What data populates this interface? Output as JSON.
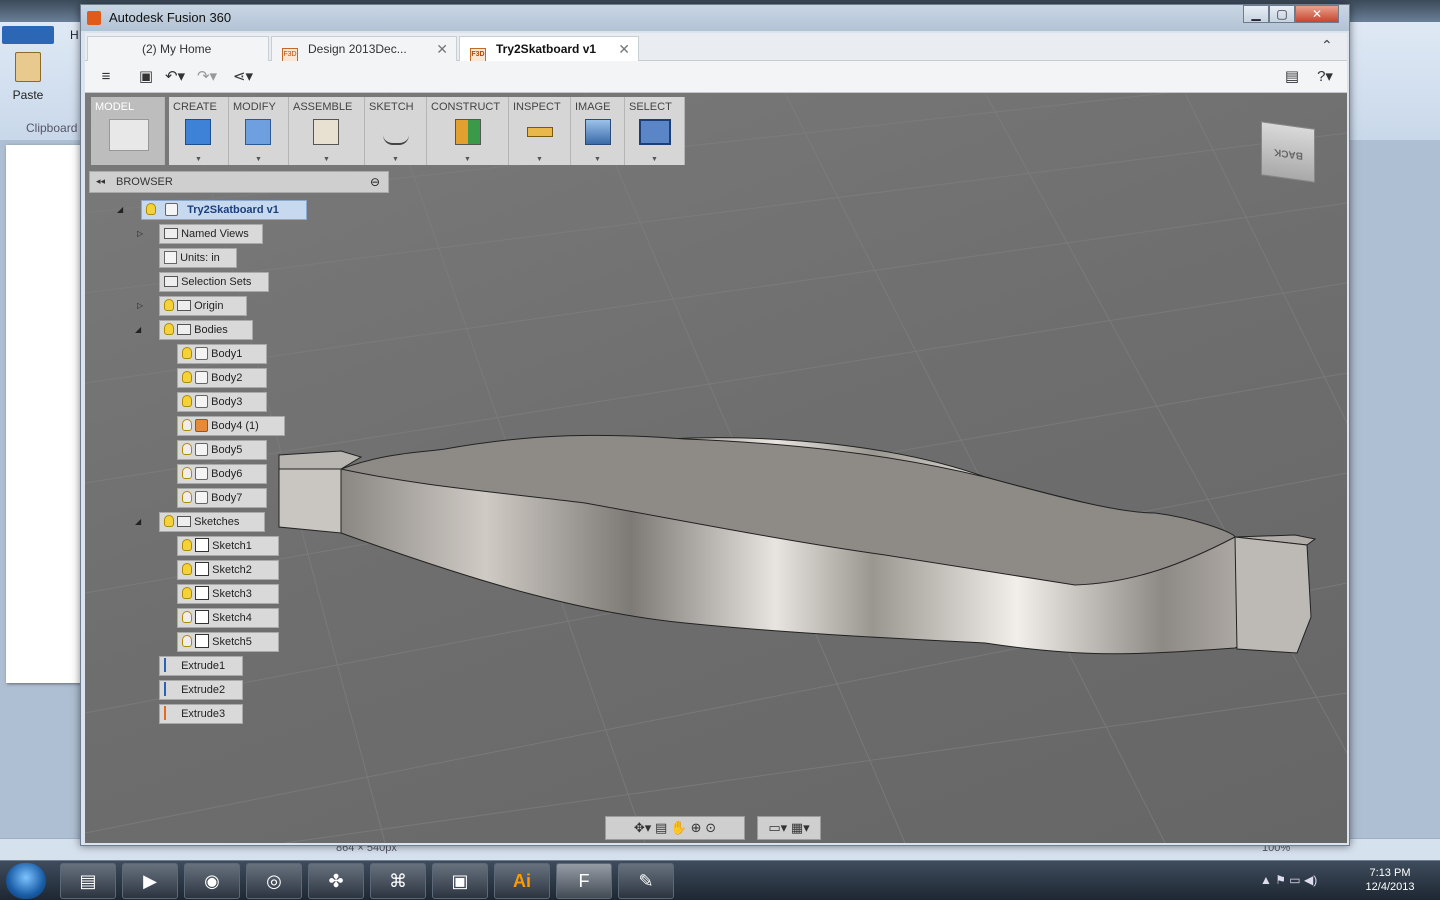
{
  "background_app": {
    "paste_label": "Paste",
    "clipboard_label": "Clipboard",
    "ribbon_tab_fragment": "H",
    "status_dimensions": "864 × 540px",
    "zoom_level": "100%"
  },
  "window": {
    "title": "Autodesk Fusion 360",
    "min_label": "▁",
    "max_label": "▢",
    "close_label": "✕"
  },
  "tabs": [
    {
      "label": "(2) My Home"
    },
    {
      "label": "Design 2013Dec..."
    },
    {
      "label": "Try2Skatboard v1"
    }
  ],
  "tab_close_label": "✕",
  "collapse_label": "⌃",
  "toolbar": {
    "groups": [
      {
        "label": "MODEL",
        "icon": "model-cube-icon"
      },
      {
        "label": "CREATE",
        "icon": "box-icon"
      },
      {
        "label": "MODIFY",
        "icon": "press-pull-icon"
      },
      {
        "label": "ASSEMBLE",
        "icon": "joint-icon"
      },
      {
        "label": "SKETCH",
        "icon": "sketch-curve-icon"
      },
      {
        "label": "CONSTRUCT",
        "icon": "plane-icon"
      },
      {
        "label": "INSPECT",
        "icon": "measure-icon"
      },
      {
        "label": "IMAGE",
        "icon": "render-icon"
      },
      {
        "label": "SELECT",
        "icon": "select-window-icon"
      }
    ],
    "dropdown_glyph": "▼"
  },
  "browser": {
    "title": "BROWSER",
    "collapse_glyph": "◂◂",
    "minus_glyph": "⊖",
    "root": "Try2Skatboard v1",
    "items": [
      {
        "label": "Named Views",
        "kind": "folder"
      },
      {
        "label": "Units: in",
        "kind": "doc"
      },
      {
        "label": "Selection Sets",
        "kind": "folder"
      },
      {
        "label": "Origin",
        "kind": "folder"
      },
      {
        "label": "Bodies",
        "kind": "folder"
      },
      {
        "label": "Body1",
        "kind": "body"
      },
      {
        "label": "Body2",
        "kind": "body"
      },
      {
        "label": "Body3",
        "kind": "body"
      },
      {
        "label": "Body4 (1)",
        "kind": "body-highlight"
      },
      {
        "label": "Body5",
        "kind": "body"
      },
      {
        "label": "Body6",
        "kind": "body"
      },
      {
        "label": "Body7",
        "kind": "body"
      },
      {
        "label": "Sketches",
        "kind": "folder"
      },
      {
        "label": "Sketch1",
        "kind": "sketch"
      },
      {
        "label": "Sketch2",
        "kind": "sketch"
      },
      {
        "label": "Sketch3",
        "kind": "sketch"
      },
      {
        "label": "Sketch4",
        "kind": "sketch"
      },
      {
        "label": "Sketch5",
        "kind": "sketch"
      },
      {
        "label": "Extrude1",
        "kind": "feature"
      },
      {
        "label": "Extrude2",
        "kind": "feature"
      },
      {
        "label": "Extrude3",
        "kind": "feature-orange"
      }
    ]
  },
  "viewcube": {
    "face_label": "BACK"
  },
  "taskbar": {
    "time": "7:13 PM",
    "date": "12/4/2013",
    "apps": [
      "file-explorer-icon",
      "media-player-icon",
      "firefox-icon",
      "chrome-icon",
      "frog-app-icon",
      "acrobat-icon",
      "nvidia-icon",
      "illustrator-icon",
      "fusion360-icon",
      "paint-icon"
    ],
    "illustrator_label": "Ai"
  },
  "colors": {
    "viewport_bg": "#707070",
    "accent_blue": "#2a62b8",
    "fusion_orange": "#e05a1a"
  }
}
